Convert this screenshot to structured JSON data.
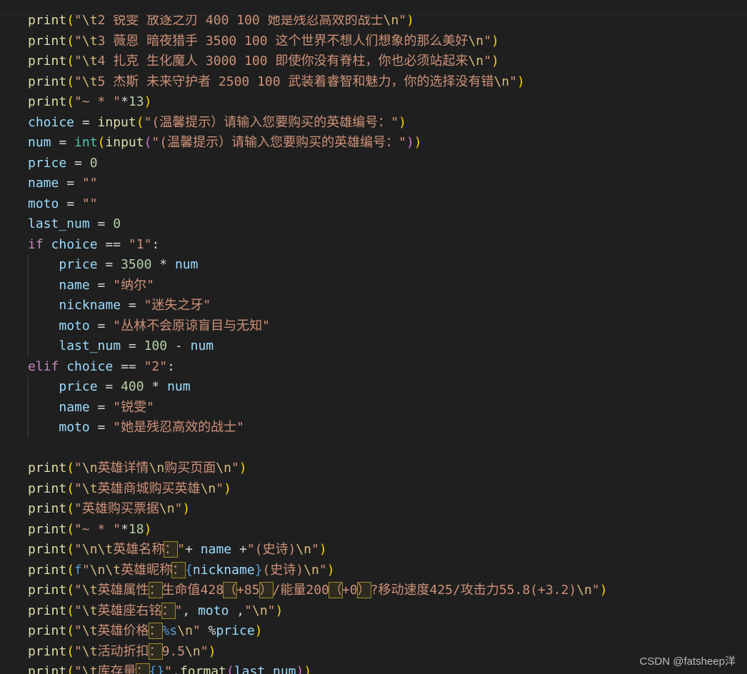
{
  "editor": {
    "lines": [
      [
        [
          "t-fn",
          "print"
        ],
        [
          "t-p1",
          "("
        ],
        [
          "t-str",
          "\""
        ],
        [
          "t-esc",
          "\\t"
        ],
        [
          "t-str",
          "2 锐雯 放逐之刃 400 100 她是残忍高效的战士"
        ],
        [
          "t-esc",
          "\\n"
        ],
        [
          "t-str",
          "\""
        ],
        [
          "t-p1",
          ")"
        ]
      ],
      [
        [
          "t-fn",
          "print"
        ],
        [
          "t-p1",
          "("
        ],
        [
          "t-str",
          "\""
        ],
        [
          "t-esc",
          "\\t"
        ],
        [
          "t-str",
          "3 薇恩 暗夜猎手 3500 100 这个世界不想人们想象的那么美好"
        ],
        [
          "t-esc",
          "\\n"
        ],
        [
          "t-str",
          "\""
        ],
        [
          "t-p1",
          ")"
        ]
      ],
      [
        [
          "t-fn",
          "print"
        ],
        [
          "t-p1",
          "("
        ],
        [
          "t-str",
          "\""
        ],
        [
          "t-esc",
          "\\t"
        ],
        [
          "t-str",
          "4 扎克 生化魔人 3000 100 即使你没有脊柱，你也必须站起来"
        ],
        [
          "t-esc",
          "\\n"
        ],
        [
          "t-str",
          "\""
        ],
        [
          "t-p1",
          ")"
        ]
      ],
      [
        [
          "t-fn",
          "print"
        ],
        [
          "t-p1",
          "("
        ],
        [
          "t-str",
          "\""
        ],
        [
          "t-esc",
          "\\t"
        ],
        [
          "t-str",
          "5 杰斯 未来守护者 2500 100 武装着睿智和魅力，你的选择没有错"
        ],
        [
          "t-esc",
          "\\n"
        ],
        [
          "t-str",
          "\""
        ],
        [
          "t-p1",
          ")"
        ]
      ],
      [
        [
          "t-fn",
          "print"
        ],
        [
          "t-p1",
          "("
        ],
        [
          "t-str",
          "\"~ * \""
        ],
        [
          "t-op",
          "*"
        ],
        [
          "t-num",
          "13"
        ],
        [
          "t-p1",
          ")"
        ]
      ],
      [
        [
          "t-var",
          "choice"
        ],
        [
          "t-op",
          " = "
        ],
        [
          "t-fn",
          "input"
        ],
        [
          "t-p1",
          "("
        ],
        [
          "t-str",
          "\"(温馨提示）请输入您要购买的英雄编号：\""
        ],
        [
          "t-p1",
          ")"
        ]
      ],
      [
        [
          "t-var",
          "num"
        ],
        [
          "t-op",
          " = "
        ],
        [
          "t-type",
          "int"
        ],
        [
          "t-p1",
          "("
        ],
        [
          "t-fn",
          "input"
        ],
        [
          "t-p2",
          "("
        ],
        [
          "t-str",
          "\"(温馨提示）请输入您要购买的英雄编号：\""
        ],
        [
          "t-p2",
          ")"
        ],
        [
          "t-p1",
          ")"
        ]
      ],
      [
        [
          "t-var",
          "price"
        ],
        [
          "t-op",
          " = "
        ],
        [
          "t-num",
          "0"
        ]
      ],
      [
        [
          "t-var",
          "name"
        ],
        [
          "t-op",
          " = "
        ],
        [
          "t-str",
          "\"\""
        ]
      ],
      [
        [
          "t-var",
          "moto"
        ],
        [
          "t-op",
          " = "
        ],
        [
          "t-str",
          "\"\""
        ]
      ],
      [
        [
          "t-var",
          "last_num"
        ],
        [
          "t-op",
          " = "
        ],
        [
          "t-num",
          "0"
        ]
      ],
      [
        [
          "t-kw",
          "if"
        ],
        [
          "t-op",
          " "
        ],
        [
          "t-var",
          "choice"
        ],
        [
          "t-op",
          " == "
        ],
        [
          "t-str",
          "\"1\""
        ],
        [
          "t-op",
          ":"
        ]
      ],
      [
        [
          "t-op",
          "    "
        ],
        [
          "t-var",
          "price"
        ],
        [
          "t-op",
          " = "
        ],
        [
          "t-num",
          "3500"
        ],
        [
          "t-op",
          " * "
        ],
        [
          "t-var",
          "num"
        ]
      ],
      [
        [
          "t-op",
          "    "
        ],
        [
          "t-var",
          "name"
        ],
        [
          "t-op",
          " = "
        ],
        [
          "t-str",
          "\"纳尔\""
        ]
      ],
      [
        [
          "t-op",
          "    "
        ],
        [
          "t-var",
          "nickname"
        ],
        [
          "t-op",
          " = "
        ],
        [
          "t-str",
          "\"迷失之牙\""
        ]
      ],
      [
        [
          "t-op",
          "    "
        ],
        [
          "t-var",
          "moto"
        ],
        [
          "t-op",
          " = "
        ],
        [
          "t-str",
          "\"丛林不会原谅盲目与无知\""
        ]
      ],
      [
        [
          "t-op",
          "    "
        ],
        [
          "t-var",
          "last_num"
        ],
        [
          "t-op",
          " = "
        ],
        [
          "t-num",
          "100"
        ],
        [
          "t-op",
          " - "
        ],
        [
          "t-var",
          "num"
        ]
      ],
      [
        [
          "t-kw",
          "elif"
        ],
        [
          "t-op",
          " "
        ],
        [
          "t-var",
          "choice"
        ],
        [
          "t-op",
          " == "
        ],
        [
          "t-str",
          "\"2\""
        ],
        [
          "t-op",
          ":"
        ]
      ],
      [
        [
          "t-op",
          "    "
        ],
        [
          "t-var",
          "price"
        ],
        [
          "t-op",
          " = "
        ],
        [
          "t-num",
          "400"
        ],
        [
          "t-op",
          " * "
        ],
        [
          "t-var",
          "num"
        ]
      ],
      [
        [
          "t-op",
          "    "
        ],
        [
          "t-var",
          "name"
        ],
        [
          "t-op",
          " = "
        ],
        [
          "t-str",
          "\"锐雯\""
        ]
      ],
      [
        [
          "t-op",
          "    "
        ],
        [
          "t-var",
          "moto"
        ],
        [
          "t-op",
          " = "
        ],
        [
          "t-str",
          "\"她是残忍高效的战士\""
        ]
      ],
      [],
      [
        [
          "t-fn",
          "print"
        ],
        [
          "t-p1",
          "("
        ],
        [
          "t-str",
          "\""
        ],
        [
          "t-esc",
          "\\n"
        ],
        [
          "t-str",
          "英雄详情"
        ],
        [
          "t-esc",
          "\\n"
        ],
        [
          "t-str",
          "购买页面"
        ],
        [
          "t-esc",
          "\\n"
        ],
        [
          "t-str",
          "\""
        ],
        [
          "t-p1",
          ")"
        ]
      ],
      [
        [
          "t-fn",
          "print"
        ],
        [
          "t-p1",
          "("
        ],
        [
          "t-str",
          "\""
        ],
        [
          "t-esc",
          "\\t"
        ],
        [
          "t-str",
          "英雄商城购买英雄"
        ],
        [
          "t-esc",
          "\\n"
        ],
        [
          "t-str",
          "\""
        ],
        [
          "t-p1",
          ")"
        ]
      ],
      [
        [
          "t-fn",
          "print"
        ],
        [
          "t-p1",
          "("
        ],
        [
          "t-str",
          "\"英雄购买票据"
        ],
        [
          "t-esc",
          "\\n"
        ],
        [
          "t-str",
          "\""
        ],
        [
          "t-p1",
          ")"
        ]
      ],
      [
        [
          "t-fn",
          "print"
        ],
        [
          "t-p1",
          "("
        ],
        [
          "t-str",
          "\"~ * \""
        ],
        [
          "t-op",
          "*"
        ],
        [
          "t-num",
          "18"
        ],
        [
          "t-p1",
          ")"
        ]
      ],
      [
        [
          "t-fn",
          "print"
        ],
        [
          "t-p1",
          "("
        ],
        [
          "t-str",
          "\""
        ],
        [
          "t-esc",
          "\\n\\t"
        ],
        [
          "t-str",
          "英雄名称"
        ],
        [
          "t-str t-hl",
          "："
        ],
        [
          "t-str",
          "\""
        ],
        [
          "t-op",
          "+ "
        ],
        [
          "t-var",
          "name"
        ],
        [
          "t-op",
          " +"
        ],
        [
          "t-str",
          "\"(史诗)"
        ],
        [
          "t-esc",
          "\\n"
        ],
        [
          "t-str",
          "\""
        ],
        [
          "t-p1",
          ")"
        ]
      ],
      [
        [
          "t-fn",
          "print"
        ],
        [
          "t-p1",
          "("
        ],
        [
          "t-fmt",
          "f"
        ],
        [
          "t-str",
          "\""
        ],
        [
          "t-esc",
          "\\n\\t"
        ],
        [
          "t-str",
          "英雄昵称"
        ],
        [
          "t-str t-hl",
          "："
        ],
        [
          "t-fmt",
          "{"
        ],
        [
          "t-var",
          "nickname"
        ],
        [
          "t-fmt",
          "}"
        ],
        [
          "t-str",
          "(史诗)"
        ],
        [
          "t-esc",
          "\\n"
        ],
        [
          "t-str",
          "\""
        ],
        [
          "t-p1",
          ")"
        ]
      ],
      [
        [
          "t-fn",
          "print"
        ],
        [
          "t-p1",
          "("
        ],
        [
          "t-str",
          "\""
        ],
        [
          "t-esc",
          "\\t"
        ],
        [
          "t-str",
          "英雄属性"
        ],
        [
          "t-str t-hl",
          "："
        ],
        [
          "t-str",
          "生命值428"
        ],
        [
          "t-str t-hl",
          "（"
        ],
        [
          "t-str",
          "+85"
        ],
        [
          "t-str t-hl",
          "）"
        ],
        [
          "t-str",
          "/能量200"
        ],
        [
          "t-str t-hl",
          "（"
        ],
        [
          "t-str",
          "+0"
        ],
        [
          "t-str t-hl",
          "）"
        ],
        [
          "t-str",
          "?移动速度425/攻击力55.8(+3.2)"
        ],
        [
          "t-esc",
          "\\n"
        ],
        [
          "t-str",
          "\""
        ],
        [
          "t-p1",
          ")"
        ]
      ],
      [
        [
          "t-fn",
          "print"
        ],
        [
          "t-p1",
          "("
        ],
        [
          "t-str",
          "\""
        ],
        [
          "t-esc",
          "\\t"
        ],
        [
          "t-str",
          "英雄座右铭"
        ],
        [
          "t-str t-hl",
          "："
        ],
        [
          "t-str",
          "\""
        ],
        [
          "t-op",
          ", "
        ],
        [
          "t-var",
          "moto"
        ],
        [
          "t-op",
          " ,"
        ],
        [
          "t-str",
          "\""
        ],
        [
          "t-esc",
          "\\n"
        ],
        [
          "t-str",
          "\""
        ],
        [
          "t-p1",
          ")"
        ]
      ],
      [
        [
          "t-fn",
          "print"
        ],
        [
          "t-p1",
          "("
        ],
        [
          "t-str",
          "\""
        ],
        [
          "t-esc",
          "\\t"
        ],
        [
          "t-str",
          "英雄价格"
        ],
        [
          "t-str t-hl",
          "："
        ],
        [
          "t-fmt",
          "%s"
        ],
        [
          "t-esc",
          "\\n"
        ],
        [
          "t-str",
          "\""
        ],
        [
          "t-op",
          " %"
        ],
        [
          "t-var",
          "price"
        ],
        [
          "t-p1",
          ")"
        ]
      ],
      [
        [
          "t-fn",
          "print"
        ],
        [
          "t-p1",
          "("
        ],
        [
          "t-str",
          "\""
        ],
        [
          "t-esc",
          "\\t"
        ],
        [
          "t-str",
          "活动折扣"
        ],
        [
          "t-str t-hl",
          "："
        ],
        [
          "t-str",
          "9.5"
        ],
        [
          "t-esc",
          "\\n"
        ],
        [
          "t-str",
          "\""
        ],
        [
          "t-p1",
          ")"
        ]
      ],
      [
        [
          "t-fn",
          "print"
        ],
        [
          "t-p1",
          "("
        ],
        [
          "t-str",
          "\""
        ],
        [
          "t-esc",
          "\\t"
        ],
        [
          "t-str",
          "库存量"
        ],
        [
          "t-str t-hl",
          "："
        ],
        [
          "t-fmt",
          "{}"
        ],
        [
          "t-str",
          "\""
        ],
        [
          "t-op",
          "."
        ],
        [
          "t-fn",
          "format"
        ],
        [
          "t-p2",
          "("
        ],
        [
          "t-var",
          "last_num"
        ],
        [
          "t-p2",
          ")"
        ],
        [
          "t-p1",
          ")"
        ]
      ]
    ]
  },
  "watermark": "CSDN @fatsheep洋"
}
